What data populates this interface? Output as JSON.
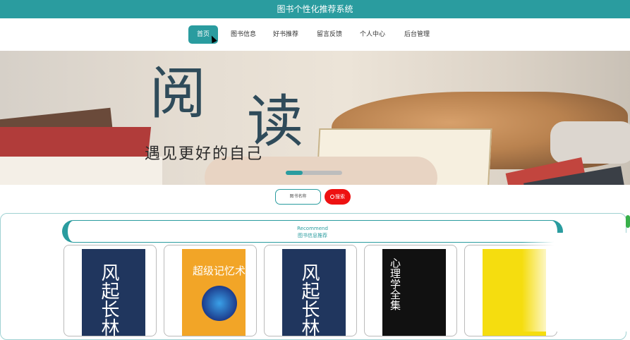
{
  "app": {
    "title": "图书个性化推荐系统"
  },
  "nav": {
    "items": [
      {
        "label": "首页",
        "active": true
      },
      {
        "label": "图书信息",
        "active": false
      },
      {
        "label": "好书推荐",
        "active": false
      },
      {
        "label": "留言反馈",
        "active": false
      },
      {
        "label": "个人中心",
        "active": false
      },
      {
        "label": "后台管理",
        "active": false
      }
    ]
  },
  "banner": {
    "char1": "阅",
    "char2": "读",
    "slogan": "遇见更好的自己"
  },
  "search": {
    "placeholder": "图书名称",
    "button_label": "搜索"
  },
  "recommend": {
    "title_en": "Recommend",
    "title_cn": "图书信息推荐"
  },
  "books": [
    {
      "cover_text": "风起长林",
      "cover_color": "#20365e"
    },
    {
      "cover_text": "超级记忆术",
      "cover_color": "#f2a527"
    },
    {
      "cover_text": "风起长林",
      "cover_color": "#20365e"
    },
    {
      "cover_text": "心理学全集",
      "cover_color": "#111111"
    },
    {
      "cover_text": "",
      "cover_color": "#f5dd0f"
    }
  ],
  "colors": {
    "accent": "#2a9c9f",
    "search_button": "#ee1111"
  }
}
